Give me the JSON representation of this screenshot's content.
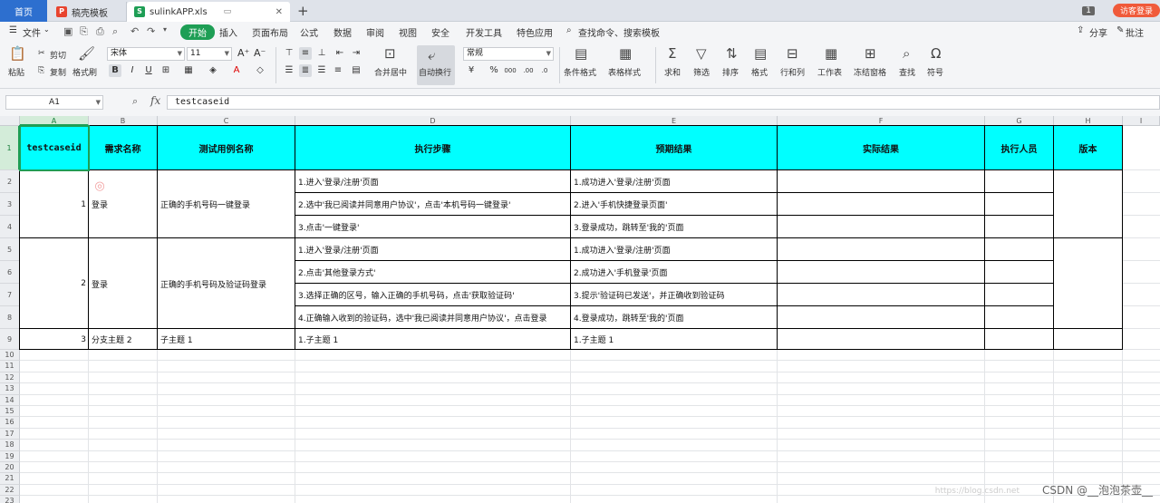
{
  "tabs": {
    "home": "首页",
    "t1": "稿壳模板",
    "t2": "sulinkAPP.xls"
  },
  "topbar": {
    "count": "1",
    "login": "访客登录"
  },
  "menu": {
    "file": "文件",
    "start": "开始",
    "items": [
      "插入",
      "页面布局",
      "公式",
      "数据",
      "审阅",
      "视图",
      "安全",
      "开发工具",
      "特色应用"
    ],
    "search": "查找命令、搜索模板",
    "share": "分享",
    "comment": "批注"
  },
  "ribbon": {
    "paste": "粘贴",
    "cut": "剪切",
    "copy": "复制",
    "format_painter": "格式刷",
    "font": "宋体",
    "size": "11",
    "merge": "合并居中",
    "autowrap": "自动换行",
    "numformat": "常规",
    "cond_format": "条件格式",
    "table_style": "表格样式",
    "sum": "求和",
    "filter": "筛选",
    "sort": "排序",
    "format": "格式",
    "rowcol": "行和列",
    "sheet": "工作表",
    "freeze": "冻结窗格",
    "find": "查找",
    "symbol": "符号"
  },
  "formula": {
    "cell_ref": "A1",
    "fx": "fx",
    "content": "testcaseid"
  },
  "columns": [
    "A",
    "B",
    "C",
    "D",
    "E",
    "F",
    "G",
    "H",
    "I"
  ],
  "rows": [
    "1",
    "2",
    "3",
    "4",
    "5",
    "6",
    "7",
    "8",
    "9",
    "10",
    "11",
    "12",
    "13",
    "14",
    "15",
    "16",
    "17",
    "18",
    "19",
    "20",
    "21",
    "22",
    "23"
  ],
  "sheet": {
    "headers": [
      "testcaseid",
      "需求名称",
      "测试用例名称",
      "执行步骤",
      "预期结果",
      "实际结果",
      "执行人员",
      "版本"
    ],
    "cases": [
      {
        "id": "1",
        "req": "登录",
        "name": "正确的手机号码一键登录",
        "steps": [
          "1.进入'登录/注册'页面",
          "2.选中'我已阅读并同意用户协议'，点击'本机号码一键登录'",
          "3.点击'一键登录'"
        ],
        "expected": [
          "1.成功进入'登录/注册'页面",
          "2.进入'手机快捷登录页面'",
          "3.登录成功，跳转至'我的'页面"
        ]
      },
      {
        "id": "2",
        "req": "登录",
        "name": "正确的手机号码及验证码登录",
        "steps": [
          "1.进入'登录/注册'页面",
          "2.点击'其他登录方式'",
          "3.选择正确的区号，输入正确的手机号码，点击'获取验证码'",
          "4.正确输入收到的验证码，选中'我已阅读并同意用户协议'，点击登录"
        ],
        "expected": [
          "1.成功进入'登录/注册'页面",
          "2.成功进入'手机登录'页面",
          "3.提示'验证码已发送'，并正确收到验证码",
          "4.登录成功，跳转至'我的'页面"
        ]
      },
      {
        "id": "3",
        "req": "分支主题 2",
        "name": "子主题 1",
        "steps": [
          "1.子主题 1"
        ],
        "expected": [
          "1.子主题 1"
        ]
      }
    ]
  },
  "watermark": "CSDN @__泡泡茶壶__",
  "watermark_soft": "https://blog.csdn.net"
}
